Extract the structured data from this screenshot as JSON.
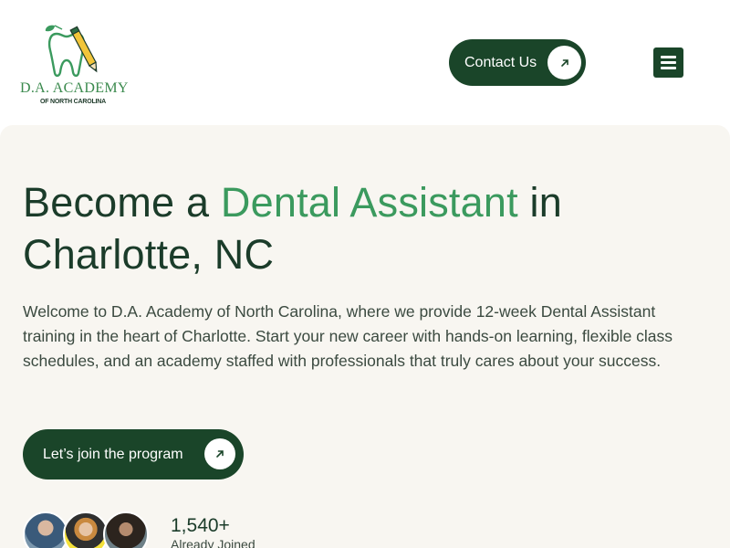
{
  "header": {
    "logo": {
      "name": "D.A. ACADEMY",
      "subtitle": "OF NORTH CAROLINA",
      "icon": "tooth-pencil-logo"
    },
    "contact_button": {
      "label": "Contact Us",
      "icon": "arrow-up-right-icon"
    },
    "menu_button": {
      "icon": "hamburger-menu-icon"
    }
  },
  "hero": {
    "title_part1": "Become a ",
    "title_accent": "Dental Assistant",
    "title_part2": " in Charlotte, NC",
    "description": "Welcome to D.A. Academy of North Carolina, where we provide 12-week Dental Assistant training in the heart of Charlotte. Start your new career with hands-on learning, flexible class schedules, and an academy staffed with professionals that truly cares about your success.",
    "cta_button": {
      "label": "Let’s join the program",
      "icon": "arrow-up-right-icon"
    },
    "social_proof": {
      "count": "1,540+",
      "label": "Already Joined",
      "avatars": [
        "avatar-student-1",
        "avatar-student-2",
        "avatar-student-3"
      ]
    }
  },
  "colors": {
    "brand_dark_green": "#1a4529",
    "accent_green": "#3b9a5e",
    "hero_background": "#f8f6f1",
    "text_dark": "#1b3c2a"
  }
}
